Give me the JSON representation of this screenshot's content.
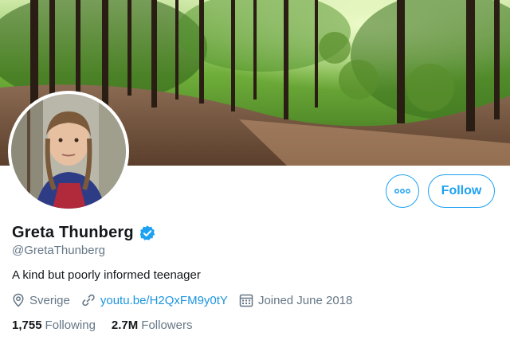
{
  "header_banner": {
    "description_icon": "forest-banner"
  },
  "profile": {
    "display_name": "Greta Thunberg",
    "handle": "@GretaThunberg",
    "verified": true,
    "bio": "A kind but poorly informed teenager",
    "location": "Sverige",
    "website": "youtu.be/H2QxFM9y0tY",
    "joined": "Joined June 2018"
  },
  "actions": {
    "more_icon": "more-icon",
    "follow_label": "Follow"
  },
  "stats": {
    "following_count": "1,755",
    "following_label": "Following",
    "followers_count": "2.7M",
    "followers_label": "Followers"
  },
  "colors": {
    "accent": "#1da1f2",
    "link": "#1b95e0",
    "secondary_text": "#657786",
    "primary_text": "#14171a"
  }
}
